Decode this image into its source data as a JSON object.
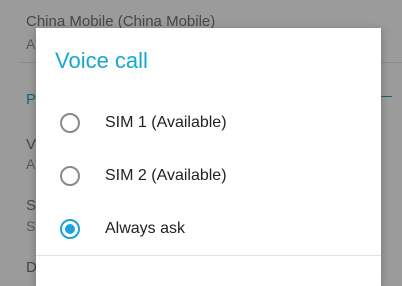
{
  "background": {
    "carrier_name": "China Mobile (China Mobile)",
    "carrier_sub": "Ac",
    "section_header": "P",
    "row1_title": "V",
    "row1_sub": "A",
    "row2_title": "S",
    "row2_sub": "S",
    "row3_title": "D"
  },
  "dialog": {
    "title": "Voice call",
    "options": [
      {
        "label": "SIM 1 (Available)",
        "checked": false
      },
      {
        "label": "SIM 2 (Available)",
        "checked": false
      },
      {
        "label": "Always ask",
        "checked": true
      }
    ]
  },
  "colors": {
    "accent": "#1ea3d8",
    "title": "#16a8cc",
    "scrim": "#9b9b9b"
  }
}
